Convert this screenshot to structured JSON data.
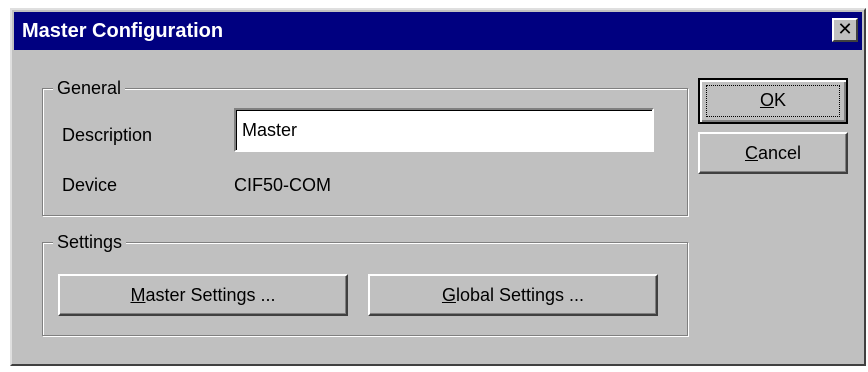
{
  "window": {
    "title": "Master Configuration",
    "close_glyph": "✕"
  },
  "general": {
    "legend": "General",
    "description_label": "Description",
    "description_value": "Master",
    "device_label": "Device",
    "device_value": "CIF50-COM"
  },
  "settings": {
    "legend": "Settings",
    "master_settings": {
      "mnemonic": "M",
      "rest": "aster Settings ..."
    },
    "global_settings": {
      "mnemonic": "G",
      "rest": "lobal Settings ..."
    }
  },
  "buttons": {
    "ok": {
      "mnemonic": "O",
      "rest": "K"
    },
    "cancel": {
      "mnemonic": "C",
      "rest": "ancel"
    }
  },
  "colors": {
    "titlebar": "#000080",
    "face": "#c0c0c0"
  }
}
